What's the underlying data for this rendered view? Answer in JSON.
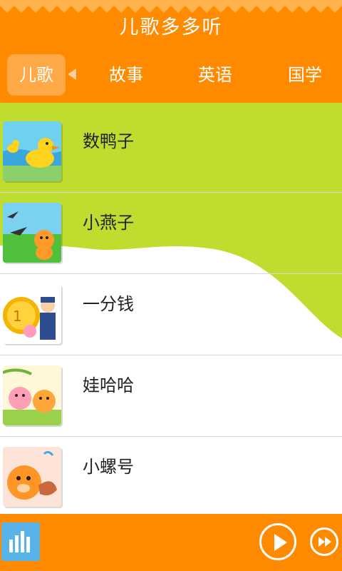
{
  "header": {
    "title": "儿歌多多听"
  },
  "tabs": [
    {
      "label": "儿歌",
      "active": true
    },
    {
      "label": "故事",
      "active": false
    },
    {
      "label": "英语",
      "active": false
    },
    {
      "label": "国学",
      "active": false
    }
  ],
  "songs": [
    {
      "title": "数鸭子",
      "thumb_icon": "duck-icon"
    },
    {
      "title": "小燕子",
      "thumb_icon": "swallow-icon"
    },
    {
      "title": "一分钱",
      "thumb_icon": "coin-icon"
    },
    {
      "title": "娃哈哈",
      "thumb_icon": "kids-icon"
    },
    {
      "title": "小螺号",
      "thumb_icon": "conch-icon"
    }
  ],
  "player": {
    "equalizer_icon": "equalizer-icon",
    "play_icon": "play-icon",
    "next_icon": "fast-forward-icon"
  },
  "colors": {
    "header_bg": "#ff8a00",
    "accent_green": "#bedd2e",
    "equalizer_bg": "#57b3e8"
  }
}
